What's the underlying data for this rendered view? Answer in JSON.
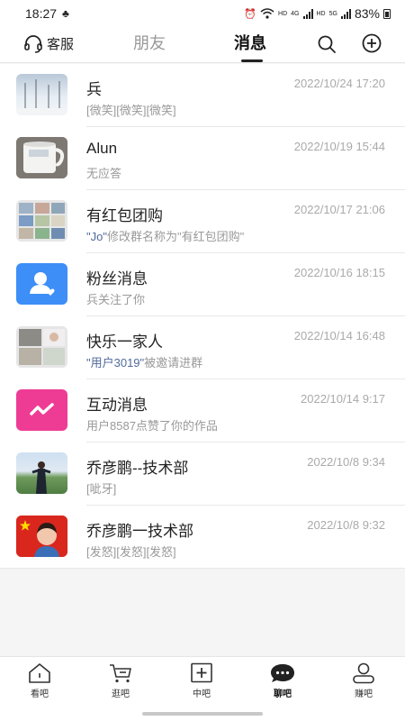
{
  "status_bar": {
    "time": "18:27",
    "net_1": "HD",
    "net_2": "4G",
    "net_3": "HD",
    "net_4": "5G",
    "battery": "83%"
  },
  "header": {
    "service_label": "客服",
    "tab_friends": "朋友",
    "tab_messages": "消息"
  },
  "messages": [
    {
      "title": "兵",
      "time": "2022/10/24 17:20",
      "preview": "[微笑][微笑][微笑]",
      "avatar": "snow-trees-photo"
    },
    {
      "title": "Alun",
      "time": "2022/10/19 15:44",
      "preview": "无应答",
      "avatar": "mug-photo"
    },
    {
      "title": "有红包团购",
      "time": "2022/10/17 21:06",
      "preview_hl": "\"Jo\"",
      "preview": "修改群名称为\"有红包团购\"",
      "avatar": "group-collage"
    },
    {
      "title": "粉丝消息",
      "time": "2022/10/16 18:15",
      "preview": "兵关注了你",
      "avatar": "fans-icon",
      "avatar_color": "#3d8ef7"
    },
    {
      "title": "快乐一家人",
      "time": "2022/10/14 16:48",
      "preview_hl": "\"用户3019\"",
      "preview": "被邀请进群",
      "avatar": "group-collage"
    },
    {
      "title": "互动消息",
      "time": "2022/10/14 9:17",
      "preview": "用户8587点赞了你的作品",
      "avatar": "interaction-icon",
      "avatar_color": "#ee3c95"
    },
    {
      "title": "乔彦鹏--技术部",
      "time": "2022/10/8 9:34",
      "preview": "[呲牙]",
      "avatar": "person-photo"
    },
    {
      "title": "乔彦鹏一技术部",
      "time": "2022/10/8 9:32",
      "preview": "[发怒][发怒][发怒]",
      "avatar": "flag-avatar"
    }
  ],
  "bottom_nav": [
    {
      "label": "看吧",
      "icon": "home-icon"
    },
    {
      "label": "逛吧",
      "icon": "cart-icon"
    },
    {
      "label": "中吧",
      "icon": "plus-square-icon"
    },
    {
      "label": "聊吧",
      "icon": "chat-icon",
      "active": true
    },
    {
      "label": "赚吧",
      "icon": "user-icon"
    }
  ]
}
